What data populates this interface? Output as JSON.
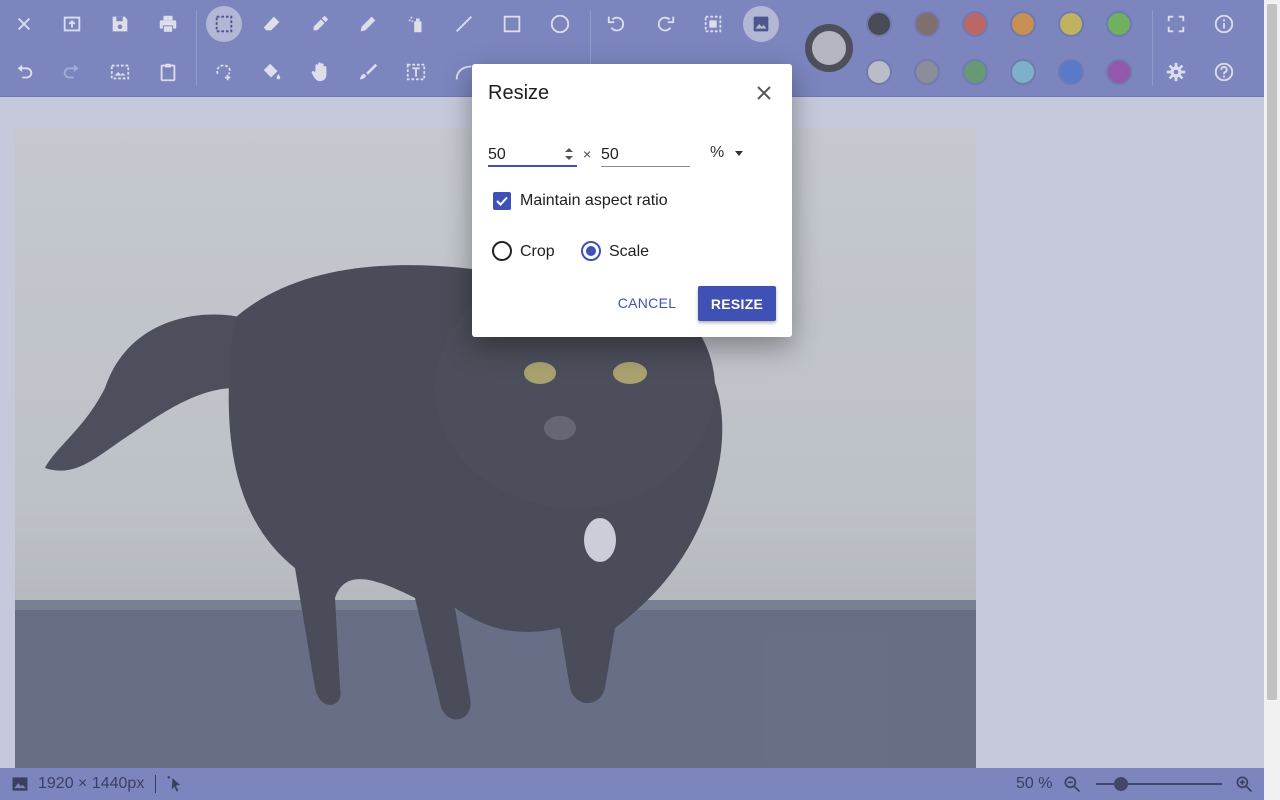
{
  "toolbar": {
    "row1": [
      "close-icon",
      "open-icon",
      "save-icon",
      "print-icon",
      "select-rectangle-icon",
      "eraser-icon",
      "color-picker-icon",
      "pencil-icon",
      "spray-icon",
      "line-icon",
      "rectangle-icon",
      "ellipse-icon",
      "rotate-left-icon",
      "rotate-right-icon",
      "crop-to-selection-icon",
      "resize-image-icon"
    ],
    "row2": [
      "undo-icon",
      "redo-icon",
      "image-from-clipboard-icon",
      "paste-icon",
      "select-freeform-icon",
      "fill-bucket-icon",
      "hand-pan-icon",
      "brush-icon",
      "text-icon",
      "curve-icon"
    ],
    "right": [
      "fullscreen-icon",
      "info-icon",
      "settings-icon",
      "help-icon"
    ],
    "active_tool": "select-rectangle",
    "active_tool_2": "resize-image"
  },
  "palette": {
    "current": "#c8c8c8",
    "row1": [
      "#333333",
      "#7e6654",
      "#d35a4a",
      "#e1952e",
      "#d7c241",
      "#6ac13f"
    ],
    "row2": [
      "#d0d0d0",
      "#8f8f8f",
      "#5ea05f",
      "#7fbfd1",
      "#4a73d2",
      "#9a46a8"
    ]
  },
  "statusbar": {
    "image_size": "1920 × 1440px",
    "zoom": "50 %"
  },
  "zoom_slider_fraction": 0.15,
  "dialog": {
    "title": "Resize",
    "width_value": "50",
    "times": "×",
    "height_value": "50",
    "unit": "%",
    "maintain_aspect": "Maintain aspect ratio",
    "maintain_aspect_checked": true,
    "options": [
      "Crop",
      "Scale"
    ],
    "selected_option": "Scale",
    "cancel": "CANCEL",
    "resize": "RESIZE"
  },
  "colors": {
    "toolbar": "#7a84c3",
    "accent": "#3f51b5"
  }
}
